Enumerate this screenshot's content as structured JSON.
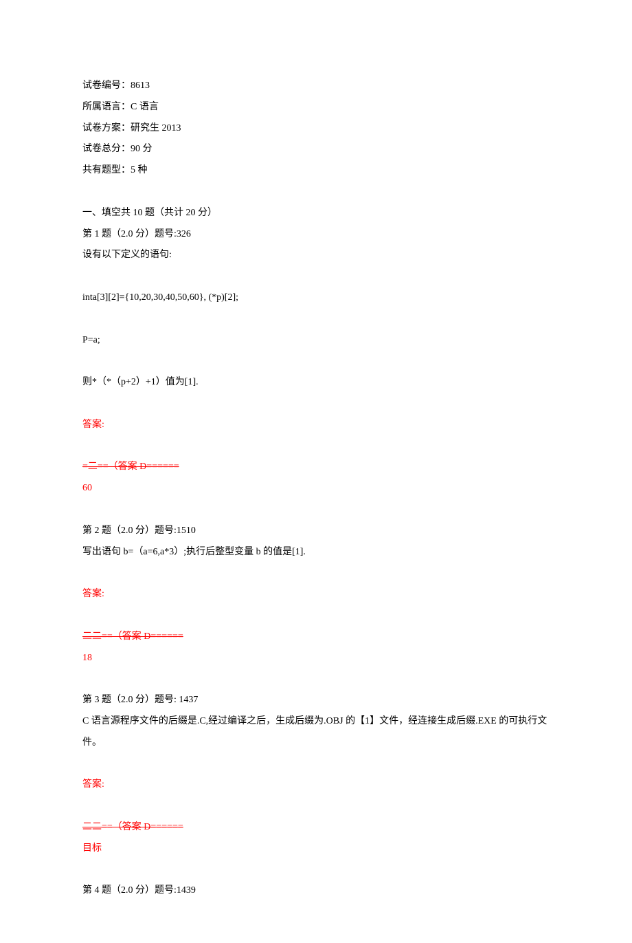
{
  "header": {
    "paper_id_label": "试卷编号：",
    "paper_id_value": "8613",
    "language_label": "所属语言：",
    "language_value": "C 语言",
    "plan_label": "试卷方案：",
    "plan_value": "研究生 2013",
    "total_score_label": "试卷总分：",
    "total_score_value": "90 分",
    "qtype_count_label": "共有题型：",
    "qtype_count_value": "5 种"
  },
  "section": {
    "title": "一、填空共 10 题（共计 20 分）"
  },
  "q1": {
    "header": "第 1 题（2.0 分）题号:326",
    "line1": "设有以下定义的语句:",
    "line2": "inta[3][2]={10,20,30,40,50,60}, (*p)[2];",
    "line3": "P=a;",
    "line4": "则*（*（p+2）+1）值为[1].",
    "ans_label": "答案:",
    "ans_marker": "=二==（答案 D======",
    "ans_value": "60"
  },
  "q2": {
    "header": "第 2 题（2.0 分）题号:1510",
    "line1": "写出语句 b=（a=6,a*3）;执行后整型变量 b 的值是[1].",
    "ans_label": "答案:",
    "ans_marker": "二二==（答案 D======",
    "ans_value": "18"
  },
  "q3": {
    "header": "第 3 题（2.0 分）题号: 1437",
    "line1": "C 语言源程序文件的后缀是.C,经过编译之后，生成后缀为.OBJ 的【1】文件，经连接生成后缀.EXE 的可执行文件。",
    "ans_label": "答案:",
    "ans_marker": "二二==（答案 D======",
    "ans_value": "目标"
  },
  "q4": {
    "header": "第 4 题（2.0 分）题号:1439"
  }
}
